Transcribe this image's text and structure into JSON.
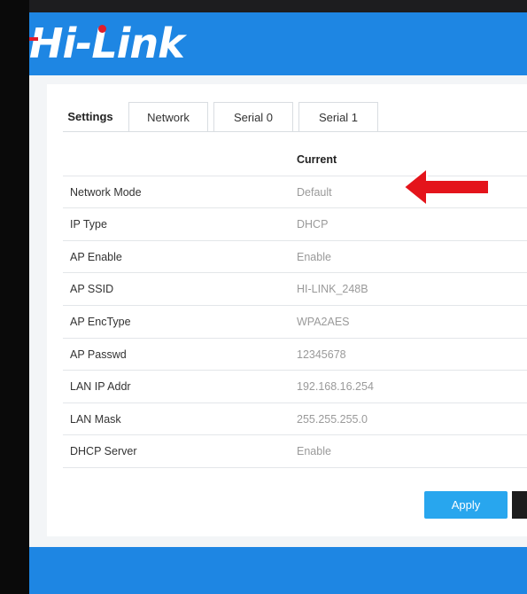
{
  "brand": {
    "logo_text": "Hi-Link"
  },
  "tabs": [
    {
      "label": "Settings"
    },
    {
      "label": "Network"
    },
    {
      "label": "Serial 0"
    },
    {
      "label": "Serial 1"
    }
  ],
  "table": {
    "column_header": "Current",
    "rows": [
      {
        "label": "Network Mode",
        "value": "Default"
      },
      {
        "label": "IP Type",
        "value": "DHCP"
      },
      {
        "label": "AP Enable",
        "value": "Enable"
      },
      {
        "label": "AP SSID",
        "value": "HI-LINK_248B"
      },
      {
        "label": "AP EncType",
        "value": "WPA2AES"
      },
      {
        "label": "AP Passwd",
        "value": "12345678"
      },
      {
        "label": "LAN IP Addr",
        "value": "192.168.16.254"
      },
      {
        "label": "LAN Mask",
        "value": "255.255.255.0"
      },
      {
        "label": "DHCP Server",
        "value": "Enable"
      }
    ]
  },
  "actions": {
    "apply_label": "Apply"
  },
  "colors": {
    "header_blue": "#1e86e3",
    "button_blue": "#28a6ee",
    "arrow_red": "#e4141b",
    "logo_red": "#e11d2a"
  },
  "icons": {
    "annotation": "left-arrow-icon"
  }
}
